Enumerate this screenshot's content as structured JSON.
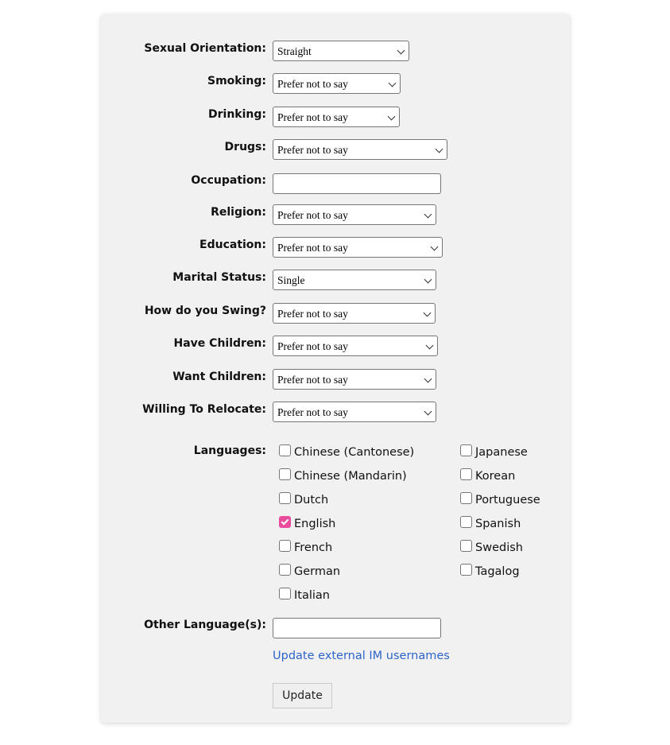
{
  "fields": [
    {
      "label": "Sexual Orientation:",
      "type": "select",
      "value": "Straight"
    },
    {
      "label": "Smoking:",
      "type": "select",
      "value": "Prefer not to say"
    },
    {
      "label": "Drinking:",
      "type": "select",
      "value": "Prefer not to say"
    },
    {
      "label": "Drugs:",
      "type": "select",
      "value": "Prefer not to say"
    },
    {
      "label": "Occupation:",
      "type": "text",
      "value": ""
    },
    {
      "label": "Religion:",
      "type": "select",
      "value": "Prefer not to say"
    },
    {
      "label": "Education:",
      "type": "select",
      "value": "Prefer not to say"
    },
    {
      "label": "Marital Status:",
      "type": "select",
      "value": "Single"
    },
    {
      "label": "How do you Swing?",
      "type": "select",
      "value": "Prefer not to say"
    },
    {
      "label": "Have Children:",
      "type": "select",
      "value": "Prefer not to say"
    },
    {
      "label": "Want Children:",
      "type": "select",
      "value": "Prefer not to say"
    },
    {
      "label": "Willing To Relocate:",
      "type": "select",
      "value": "Prefer not to say"
    }
  ],
  "languages": {
    "label": "Languages:",
    "options": [
      {
        "name": "Chinese (Cantonese)",
        "checked": false
      },
      {
        "name": "Chinese (Mandarin)",
        "checked": false
      },
      {
        "name": "Dutch",
        "checked": false
      },
      {
        "name": "English",
        "checked": true
      },
      {
        "name": "French",
        "checked": false
      },
      {
        "name": "German",
        "checked": false
      },
      {
        "name": "Italian",
        "checked": false
      },
      {
        "name": "Japanese",
        "checked": false
      },
      {
        "name": "Korean",
        "checked": false
      },
      {
        "name": "Portuguese",
        "checked": false
      },
      {
        "name": "Spanish",
        "checked": false
      },
      {
        "name": "Swedish",
        "checked": false
      },
      {
        "name": "Tagalog",
        "checked": false
      }
    ]
  },
  "other_languages": {
    "label": "Other Language(s):",
    "value": ""
  },
  "im_link": "Update external IM usernames",
  "update_button": "Update",
  "colors": {
    "accent": "#e84c9b",
    "link": "#2d64c9",
    "panel": "#f1f1f1"
  }
}
